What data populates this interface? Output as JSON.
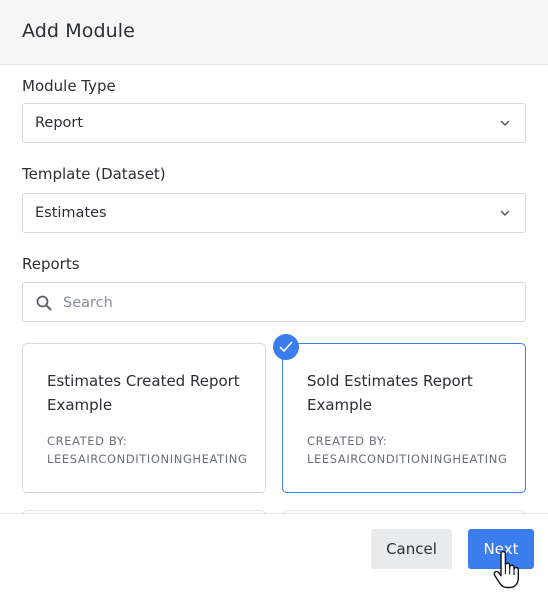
{
  "dialog": {
    "title": "Add Module"
  },
  "module_type": {
    "label": "Module Type",
    "value": "Report"
  },
  "template": {
    "label": "Template (Dataset)",
    "value": "Estimates"
  },
  "reports": {
    "label": "Reports",
    "search_placeholder": "Search",
    "cards": [
      {
        "title": "Estimates Created Report Example",
        "created_by_label": "CREATED BY:",
        "created_by": "LEESAIRCONDITIONINGHEATING",
        "selected": false
      },
      {
        "title": "Sold Estimates Report Example",
        "created_by_label": "CREATED BY:",
        "created_by": "LEESAIRCONDITIONINGHEATING",
        "selected": true
      }
    ]
  },
  "footer": {
    "cancel_label": "Cancel",
    "next_label": "Next"
  },
  "colors": {
    "accent": "#3b7ded",
    "header_bg": "#f6f6f7",
    "border": "#d7d9dd"
  },
  "icons": {
    "select_chevron": "chevron-down-icon",
    "search": "search-icon",
    "selected_badge": "checkmark-icon",
    "cursor": "hand-pointer-cursor"
  }
}
